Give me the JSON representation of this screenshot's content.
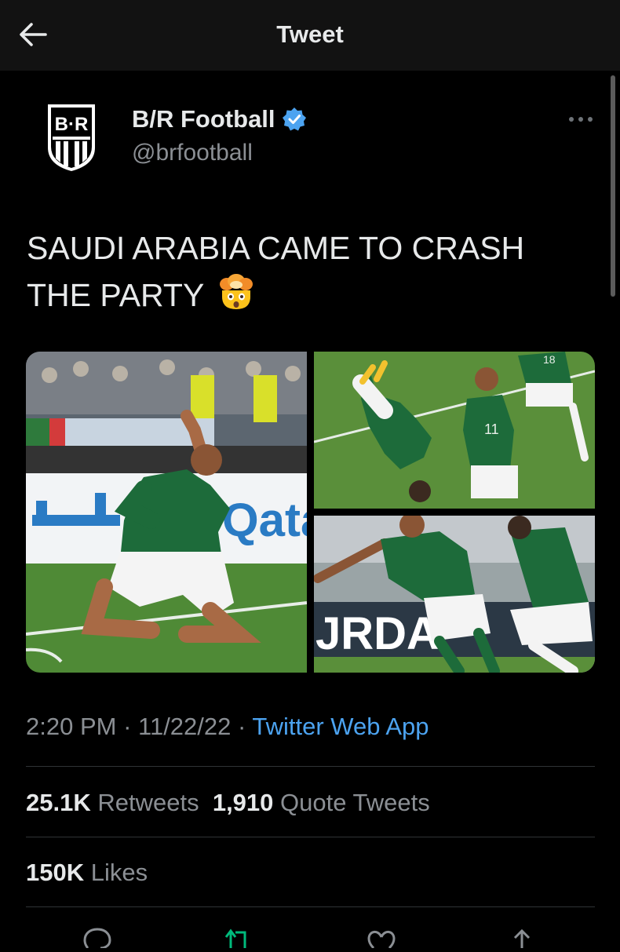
{
  "header": {
    "title": "Tweet",
    "back_icon": "arrow-left-icon"
  },
  "author": {
    "display_name": "B/R Football",
    "handle": "@brfootball",
    "logo_text": "B·R",
    "verified_icon": "verified-badge-icon",
    "more_icon": "more-horizontal-icon"
  },
  "tweet": {
    "text": "SAUDI ARABIA CAME TO CRASH THE PARTY",
    "emoji": "exploding-head-emoji",
    "media": [
      {
        "name": "photo-1",
        "banner_text": "Qata"
      },
      {
        "name": "photo-2",
        "jersey_number": "18",
        "second_number": "11"
      },
      {
        "name": "photo-3",
        "banner_text": "JRDA"
      }
    ],
    "time": "2:20 PM",
    "separator": " · ",
    "date": "11/22/22",
    "source": "Twitter Web App"
  },
  "stats": {
    "retweets_count": "25.1K",
    "retweets_label": "Retweets",
    "quotes_count": "1,910",
    "quotes_label": "Quote Tweets",
    "likes_count": "150K",
    "likes_label": "Likes"
  },
  "actions": [
    "reply-icon",
    "retweet-icon",
    "like-icon",
    "share-icon"
  ],
  "colors": {
    "background": "#000000",
    "topbar": "#121212",
    "accent": "#4ca3f0",
    "muted": "#8b8f94",
    "retweet_green": "#00ba7c"
  }
}
